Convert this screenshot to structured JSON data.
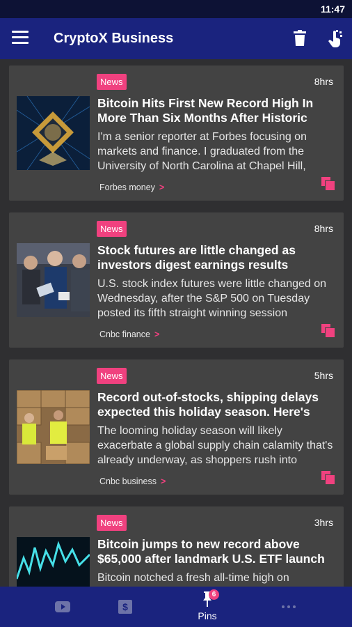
{
  "status_bar": {
    "time": "11:47"
  },
  "app_bar": {
    "title": "CryptoX Business"
  },
  "articles": [
    {
      "badge": "News",
      "time": "8hrs",
      "headline": "Bitcoin Hits First New Record High In More Than Six Months After Historic",
      "summary": "I'm a senior reporter at Forbes focusing on markets and finance. I graduated from the University of North Carolina at Chapel Hill,",
      "source": "Forbes money"
    },
    {
      "badge": "News",
      "time": "8hrs",
      "headline": "Stock futures are little changed as investors digest earnings results",
      "summary": "U.S. stock index futures were little changed on Wednesday, after the S&P 500 on Tuesday posted its fifth straight winning session",
      "source": "Cnbc finance"
    },
    {
      "badge": "News",
      "time": "5hrs",
      "headline": "Record out-of-stocks, shipping delays expected this holiday season. Here's who",
      "summary": "The looming holiday season will likely exacerbate a global supply chain calamity that's already underway, as shoppers rush into",
      "source": "Cnbc business"
    },
    {
      "badge": "News",
      "time": "3hrs",
      "headline": "Bitcoin jumps to new record above $65,000 after landmark U.S. ETF launch",
      "summary": "Bitcoin notched a fresh all-time high on",
      "source": ""
    }
  ],
  "bottom_nav": {
    "pins_label": "Pins",
    "pins_count": "6",
    "icons": [
      "youtube-icon",
      "dollar-icon",
      "pin-icon",
      "more-icon"
    ]
  },
  "colors": {
    "app_bar": "#1a237e",
    "accent": "#f0417f",
    "card": "#434343",
    "background": "#2f2f31"
  }
}
